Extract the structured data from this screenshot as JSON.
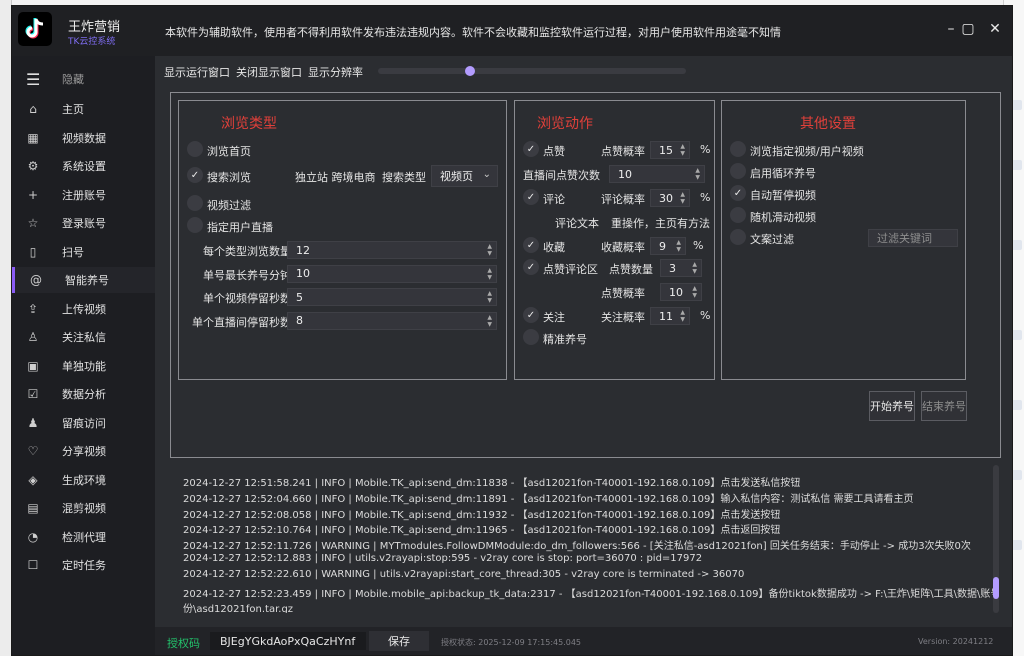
{
  "window": {
    "app_name": "王炸营销",
    "app_subtitle": "TK云控系统",
    "notice": "本软件为辅助软件，使用者不得利用软件发布违法违规内容。软件不会收藏和监控软件运行过程，对用户使用软件用途毫不知情"
  },
  "sidebar": {
    "hide_label": "隐藏",
    "items": [
      {
        "label": "主页",
        "icon": "home-icon",
        "glyph": "⌂"
      },
      {
        "label": "视频数据",
        "icon": "film-icon",
        "glyph": "▦"
      },
      {
        "label": "系统设置",
        "icon": "gear-icon",
        "glyph": "⚙"
      },
      {
        "label": "注册账号",
        "icon": "plus-icon",
        "glyph": "+"
      },
      {
        "label": "登录账号",
        "icon": "star-icon",
        "glyph": "☆"
      },
      {
        "label": "扫号",
        "icon": "phone-icon",
        "glyph": "▯"
      },
      {
        "label": "智能养号",
        "icon": "at-icon",
        "glyph": "@"
      },
      {
        "label": "上传视频",
        "icon": "cloud-upload-icon",
        "glyph": "⇪"
      },
      {
        "label": "关注私信",
        "icon": "user-add-icon",
        "glyph": "♙"
      },
      {
        "label": "单独功能",
        "icon": "mk-icon",
        "glyph": "▣"
      },
      {
        "label": "数据分析",
        "icon": "calendar-check-icon",
        "glyph": "☑"
      },
      {
        "label": "留痕访问",
        "icon": "users-icon",
        "glyph": "♟"
      },
      {
        "label": "分享视频",
        "icon": "heart-icon",
        "glyph": "♡"
      },
      {
        "label": "生成环境",
        "icon": "layers-icon",
        "glyph": "◈"
      },
      {
        "label": "混剪视频",
        "icon": "film-strip-icon",
        "glyph": "▤"
      },
      {
        "label": "检测代理",
        "icon": "rss-icon",
        "glyph": "◔"
      },
      {
        "label": "定时任务",
        "icon": "checklist-icon",
        "glyph": "☐"
      }
    ]
  },
  "options_bar": {
    "show_run_window": "显示运行窗口",
    "close_window": "关闭显示窗口",
    "show_resolution": "显示分辨率",
    "resolution_level": 0.3
  },
  "browse_type": {
    "title": "浏览类型",
    "home": "浏览首页",
    "search": "搜索浏览",
    "search_keyword": "独立站 跨境电商",
    "search_type_label": "搜索类型",
    "search_type_value": "视频页",
    "video_filter": "视频过滤",
    "live_user": "指定用户直播",
    "fields": [
      {
        "label": "每个类型浏览数量",
        "value": "12"
      },
      {
        "label": "单号最长养号分钟",
        "value": "10"
      },
      {
        "label": "单个视频停留秒数",
        "value": "5"
      },
      {
        "label": "单个直播间停留秒数",
        "value": "8"
      }
    ]
  },
  "browse_action": {
    "title": "浏览动作",
    "like": "点赞",
    "like_rate_label": "点赞概率",
    "like_rate": "15",
    "live_like_label": "直播间点赞次数",
    "live_like": "10",
    "comment": "评论",
    "comment_rate_label": "评论概率",
    "comment_rate": "30",
    "comment_text_label": "评论文本",
    "comment_text": "重操作，主页有方法",
    "collect": "收藏",
    "collect_rate_label": "收藏概率",
    "collect_rate": "9",
    "comment_area_like": "点赞评论区",
    "like_count_label": "点赞数量",
    "like_count": "3",
    "like_rate2_label": "点赞概率",
    "like_rate2": "10",
    "follow": "关注",
    "follow_rate_label": "关注概率",
    "follow_rate": "11",
    "precise": "精准养号",
    "percent": "%"
  },
  "other_settings": {
    "title": "其他设置",
    "items": [
      "浏览指定视频/用户视频",
      "启用循环养号",
      "自动暂停视频",
      "随机滑动视频",
      "文案过滤"
    ],
    "filter_placeholder": "过滤关键词",
    "start_button": "开始养号",
    "stop_button": "结束养号"
  },
  "log": [
    "2024-12-27 12:51:58.241 | INFO     | Mobile.TK_api:send_dm:11838 - 【asd12021fon-T40001-192.168.0.109】点击发送私信按钮",
    "2024-12-27 12:52:04.660 | INFO     | Mobile.TK_api:send_dm:11891 - 【asd12021fon-T40001-192.168.0.109】输入私信内容：测试私信 需要工具请看主页",
    "2024-12-27 12:52:08.058 | INFO     | Mobile.TK_api:send_dm:11932 - 【asd12021fon-T40001-192.168.0.109】点击发送按钮",
    "2024-12-27 12:52:10.764 | INFO     | Mobile.TK_api:send_dm:11965 - 【asd12021fon-T40001-192.168.0.109】点击返回按钮",
    "2024-12-27 12:52:11.726 | WARNING  | MYTmodules.FollowDMModule:do_dm_followers:566 - [关注私信-asd12021fon] 回关任务结束：手动停止 -> 成功3次失败0次",
    "2024-12-27 12:52:12.883 | INFO     | utils.v2rayapi:stop:595 - v2ray core is stop: port=36070 : pid=17972",
    "2024-12-27 12:52:22.610 | WARNING  | utils.v2rayapi:start_core_thread:305 - v2ray core is terminated -> 36070",
    "2024-12-27 12:52:23.459 | INFO     | Mobile.mobile_api:backup_tk_data:2317 - 【asd12021fon-T40001-192.168.0.109】备份tiktok数据成功 -> F:\\王炸\\矩阵\\工具\\数据\\账号备",
    "份\\asd12021fon.tar.gz"
  ],
  "footer": {
    "license_label": "授权码",
    "license_code": "BJEgYGkdAoPxQaCzHYnf",
    "save_button": "保存",
    "auth_status": "授权状态: 2025-12-09 17:15:45.045",
    "version": "Version: 20241212"
  },
  "colors": {
    "accent": "#8b5cf6",
    "group_title": "#e0403a",
    "license": "#23c16b"
  }
}
